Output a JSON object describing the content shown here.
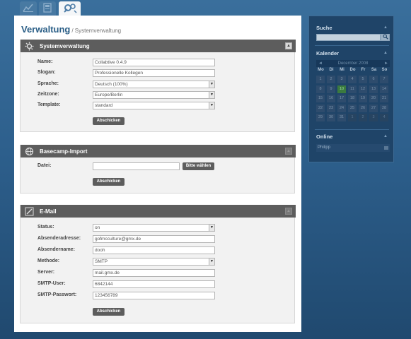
{
  "header": {
    "page_title": "Verwaltung",
    "breadcrumb": "/ Systemverwaltung",
    "tabs": [
      {
        "icon": "chart-icon"
      },
      {
        "icon": "document-icon"
      },
      {
        "icon": "tools-icon",
        "active": true
      }
    ]
  },
  "panels": {
    "system": {
      "title": "Systemverwaltung",
      "icon": "gear-icon",
      "fields": [
        {
          "label": "Name:",
          "value": "Collabtive 0.4.9",
          "type": "text"
        },
        {
          "label": "Slogan:",
          "value": "Professionelle Kollegen",
          "type": "text"
        },
        {
          "label": "Sprache:",
          "value": "Deutsch (100%)",
          "type": "select"
        },
        {
          "label": "Zeitzone:",
          "value": "Europe/Berlin",
          "type": "select"
        },
        {
          "label": "Template:",
          "value": "standard",
          "type": "select"
        }
      ],
      "submit_label": "Abschicken"
    },
    "basecamp": {
      "title": "Basecamp-Import",
      "icon": "globe-icon",
      "file_label": "Datei:",
      "file_value": "",
      "browse_label": "Bitte wählen",
      "submit_label": "Abschicken"
    },
    "email": {
      "title": "E-Mail",
      "icon": "pencil-icon",
      "fields": [
        {
          "label": "Status:",
          "value": "on",
          "type": "select"
        },
        {
          "label": "Absenderadresse:",
          "value": "gofmcculture@gmx.de",
          "type": "text"
        },
        {
          "label": "Absendername:",
          "value": "dooh",
          "type": "text"
        },
        {
          "label": "Methode:",
          "value": "SMTP",
          "type": "select"
        },
        {
          "label": "Server:",
          "value": "mail.gmx.de",
          "type": "text"
        },
        {
          "label": "SMTP-User:",
          "value": "6842144",
          "type": "text"
        },
        {
          "label": "SMTP-Passwort:",
          "value": "123456789",
          "type": "text"
        }
      ],
      "submit_label": "Abschicken"
    }
  },
  "sidebar": {
    "search": {
      "heading": "Suche",
      "value": ""
    },
    "calendar": {
      "heading": "Kalender",
      "month": "December 2008",
      "prev": "◄",
      "next": "►",
      "weekdays": [
        "Mo",
        "Di",
        "Mi",
        "Do",
        "Fr",
        "Sa",
        "So"
      ],
      "weeks": [
        [
          "1",
          "2",
          "3",
          "4",
          "5",
          "6",
          "7"
        ],
        [
          "8",
          "9",
          "10",
          "11",
          "12",
          "13",
          "14"
        ],
        [
          "15",
          "16",
          "17",
          "18",
          "19",
          "20",
          "21"
        ],
        [
          "22",
          "23",
          "24",
          "25",
          "26",
          "27",
          "28"
        ],
        [
          "29",
          "30",
          "31",
          "1",
          "2",
          "3",
          "4"
        ]
      ],
      "today": "10"
    },
    "online": {
      "heading": "Online",
      "users": [
        "Philipp"
      ]
    }
  },
  "colors": {
    "background": "#2d5f8c",
    "panel_header": "#5d5d5d",
    "title_blue": "#2b5f87",
    "sidebar_bg": "#1f4468"
  }
}
